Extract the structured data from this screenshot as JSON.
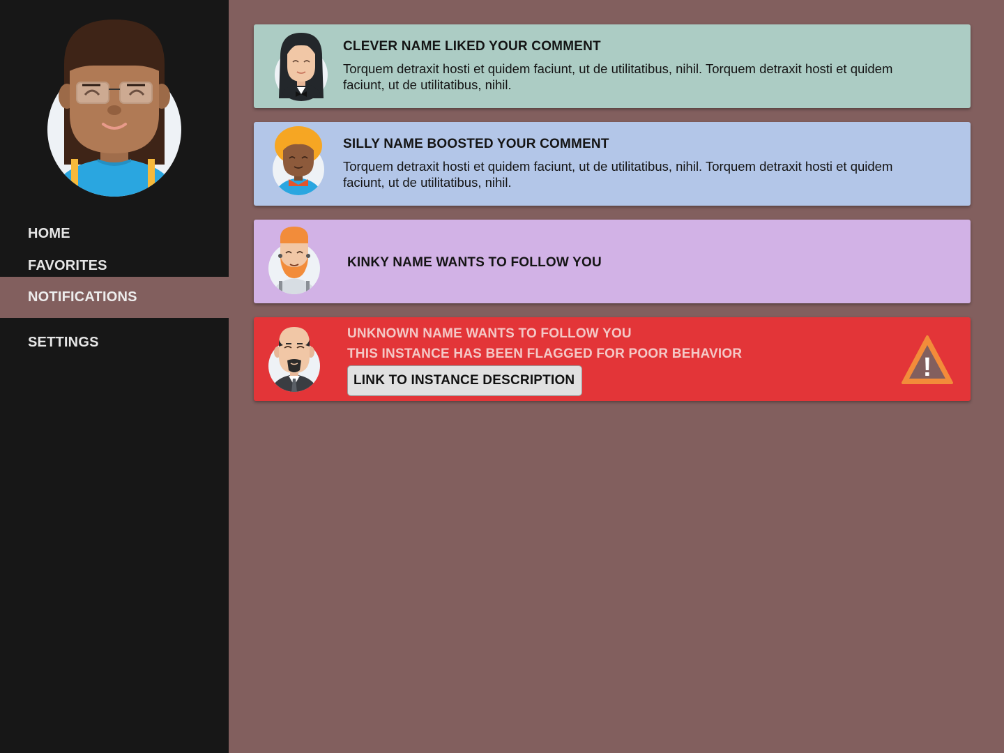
{
  "sidebar": {
    "profile_avatar_icon": "user-avatar-glasses-icon",
    "nav": [
      {
        "label": "HOME",
        "active": false
      },
      {
        "label": "FAVORITES",
        "active": false
      },
      {
        "label": "NOTIFICATIONS",
        "active": true
      },
      {
        "label": "SETTINGS",
        "active": false
      }
    ]
  },
  "colors": {
    "sidebar_bg": "#171717",
    "page_bg": "#825f5e",
    "like_card": "#acccc4",
    "boost_card": "#b3c6e8",
    "follow_card": "#d2b2e6",
    "flagged_card": "#e33538",
    "warning_orange": "#f28c3a"
  },
  "notifications": [
    {
      "type": "like",
      "avatar_icon": "avatar-long-hair-icon",
      "title": "CLEVER NAME LIKED YOUR COMMENT",
      "body": "Torquem detraxit hosti et quidem faciunt, ut de utilitatibus, nihil. Torquem detraxit hosti et quidem faciunt, ut de utilitatibus, nihil."
    },
    {
      "type": "boost",
      "avatar_icon": "avatar-curly-hair-icon",
      "title": "SILLY NAME BOOSTED YOUR COMMENT",
      "body": "Torquem detraxit hosti et quidem faciunt, ut de utilitatibus, nihil. Torquem detraxit hosti et quidem faciunt, ut de utilitatibus, nihil."
    },
    {
      "type": "follow",
      "avatar_icon": "avatar-bearded-icon",
      "title": "KINKY NAME WANTS TO FOLLOW YOU"
    },
    {
      "type": "flagged-follow",
      "avatar_icon": "avatar-bald-goatee-icon",
      "title": "UNKNOWN NAME WANTS TO FOLLOW YOU",
      "warning": "THIS INSTANCE HAS BEEN FLAGGED FOR POOR BEHAVIOR",
      "link_label": "LINK TO INSTANCE DESCRIPTION",
      "alert_icon": "warning-triangle-icon",
      "alert_glyph": "!"
    }
  ]
}
